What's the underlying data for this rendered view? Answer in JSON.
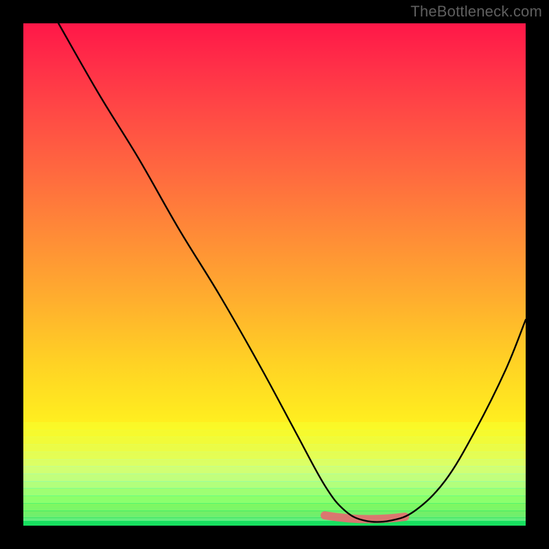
{
  "watermark": "TheBottleneck.com",
  "colors": {
    "background": "#000000",
    "curve": "#000000",
    "highlight": "#e07070",
    "green_bottom": "#18e060"
  },
  "chart_data": {
    "type": "line",
    "title": "",
    "xlabel": "",
    "ylabel": "",
    "xlim": [
      0,
      100
    ],
    "ylim": [
      0,
      100
    ],
    "grid": false,
    "series": [
      {
        "name": "bottleneck-curve",
        "x": [
          7,
          15,
          23,
          31,
          39,
          47,
          54,
          60,
          64,
          68,
          73,
          78,
          84,
          90,
          96,
          100
        ],
        "y": [
          100,
          86,
          73,
          59,
          46,
          32,
          19,
          8,
          3,
          1,
          1,
          3,
          9,
          19,
          31,
          41
        ]
      }
    ],
    "highlight_range": {
      "x_start": 60,
      "x_end": 76,
      "y": 1.5
    },
    "background_gradient_stops": [
      {
        "pos": 0.0,
        "color": "#ff1748"
      },
      {
        "pos": 0.18,
        "color": "#ff4a45"
      },
      {
        "pos": 0.42,
        "color": "#ff8b37"
      },
      {
        "pos": 0.68,
        "color": "#ffd324"
      },
      {
        "pos": 0.88,
        "color": "#fcff28"
      },
      {
        "pos": 0.98,
        "color": "#d7ff7a"
      },
      {
        "pos": 1.0,
        "color": "#6cff98"
      }
    ],
    "bottom_stripe_colors": [
      "#f6ff2e",
      "#efff3a",
      "#e6ff4d",
      "#dcff62",
      "#d0ff7a",
      "#c1ff95",
      "#aeffae",
      "#96ffbb",
      "#7affb6",
      "#5affa0",
      "#3eff88",
      "#28f070",
      "#1ce263",
      "#18e060"
    ]
  }
}
